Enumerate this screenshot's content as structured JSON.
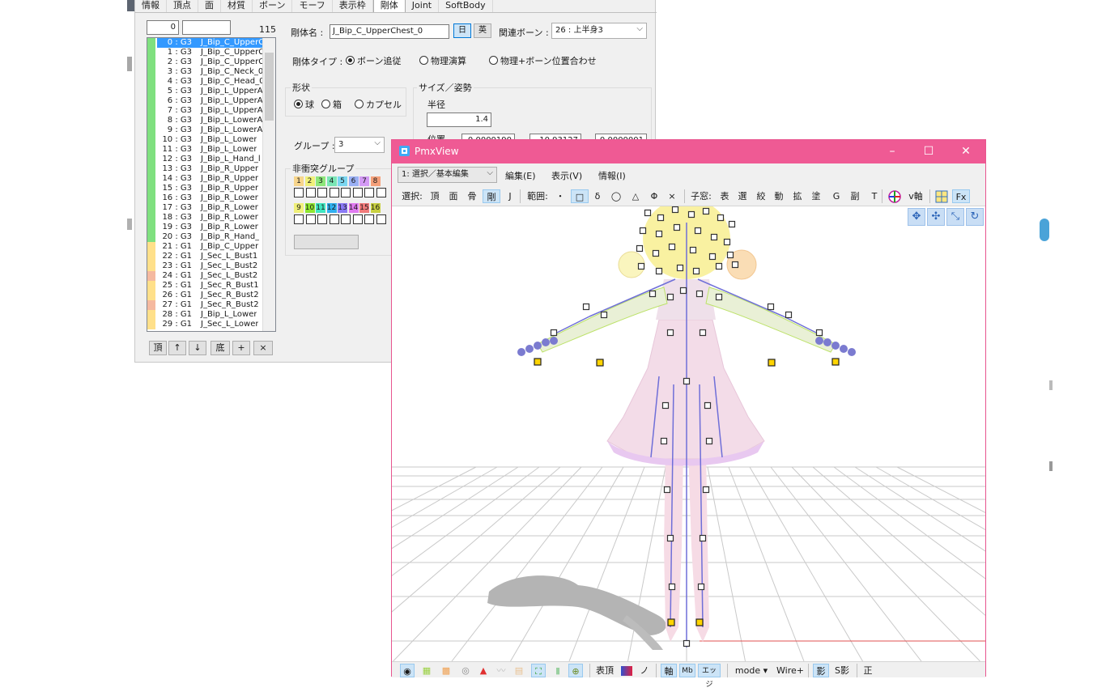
{
  "editor": {
    "tabs": [
      "情報",
      "頂点",
      "面",
      "材質",
      "ボーン",
      "モーフ",
      "表示枠",
      "剛体",
      "Joint",
      "SoftBody"
    ],
    "active_tab": "剛体",
    "index_value": "0",
    "search_value": "",
    "total_count": "115",
    "list_items": [
      {
        "id": "0 : G3",
        "name": "J_Bip_C_UpperC",
        "color": "#7fe07f"
      },
      {
        "id": "1 : G3",
        "name": "J_Bip_C_UpperC",
        "color": "#7fe07f"
      },
      {
        "id": "2 : G3",
        "name": "J_Bip_C_UpperC",
        "color": "#7fe07f"
      },
      {
        "id": "3 : G3",
        "name": "J_Bip_C_Neck_0",
        "color": "#7fe07f"
      },
      {
        "id": "4 : G3",
        "name": "J_Bip_C_Head_0",
        "color": "#7fe07f"
      },
      {
        "id": "5 : G3",
        "name": "J_Bip_L_UpperA",
        "color": "#7fe07f"
      },
      {
        "id": "6 : G3",
        "name": "J_Bip_L_UpperA",
        "color": "#7fe07f"
      },
      {
        "id": "7 : G3",
        "name": "J_Bip_L_UpperA",
        "color": "#7fe07f"
      },
      {
        "id": "8 : G3",
        "name": "J_Bip_L_LowerA",
        "color": "#7fe07f"
      },
      {
        "id": "9 : G3",
        "name": "J_Bip_L_LowerA",
        "color": "#7fe07f"
      },
      {
        "id": "10 : G3",
        "name": "J_Bip_L_Lower",
        "color": "#7fe07f"
      },
      {
        "id": "11 : G3",
        "name": "J_Bip_L_Lower",
        "color": "#7fe07f"
      },
      {
        "id": "12 : G3",
        "name": "J_Bip_L_Hand_l",
        "color": "#7fe07f"
      },
      {
        "id": "13 : G3",
        "name": "J_Bip_R_Upper",
        "color": "#7fe07f"
      },
      {
        "id": "14 : G3",
        "name": "J_Bip_R_Upper",
        "color": "#7fe07f"
      },
      {
        "id": "15 : G3",
        "name": "J_Bip_R_Upper",
        "color": "#7fe07f"
      },
      {
        "id": "16 : G3",
        "name": "J_Bip_R_Lower",
        "color": "#7fe07f"
      },
      {
        "id": "17 : G3",
        "name": "J_Bip_R_Lower",
        "color": "#7fe07f"
      },
      {
        "id": "18 : G3",
        "name": "J_Bip_R_Lower",
        "color": "#7fe07f"
      },
      {
        "id": "19 : G3",
        "name": "J_Bip_R_Lower",
        "color": "#7fe07f"
      },
      {
        "id": "20 : G3",
        "name": "J_Bip_R_Hand_",
        "color": "#7fe07f"
      },
      {
        "id": "21 : G1",
        "name": "J_Bip_C_Upper",
        "color": "#ffe08a"
      },
      {
        "id": "22 : G1",
        "name": "J_Sec_L_Bust1",
        "color": "#ffe08a"
      },
      {
        "id": "23 : G1",
        "name": "J_Sec_L_Bust2",
        "color": "#ffe08a"
      },
      {
        "id": "24 : G1",
        "name": "J_Sec_L_Bust2",
        "color": "#f5b9a0"
      },
      {
        "id": "25 : G1",
        "name": "J_Sec_R_Bust1",
        "color": "#ffe08a"
      },
      {
        "id": "26 : G1",
        "name": "J_Sec_R_Bust2",
        "color": "#ffe08a"
      },
      {
        "id": "27 : G1",
        "name": "J_Sec_R_Bust2",
        "color": "#f5b9a0"
      },
      {
        "id": "28 : G1",
        "name": "J_Bip_L_Lower",
        "color": "#ffe08a"
      },
      {
        "id": "29 : G1",
        "name": "J_Sec_L_Lower",
        "color": "#ffe08a"
      }
    ],
    "list_buttons": [
      "頂",
      "↑",
      "↓",
      "底",
      "+",
      "×"
    ],
    "body_name_label": "剛体名 :",
    "body_name_value": "J_Bip_C_UpperChest_0",
    "lang_jp": "日",
    "lang_en": "英",
    "related_bone_label": "関連ボーン :",
    "related_bone_value": "26 : 上半身3",
    "body_type_label": "剛体タイプ :",
    "body_types": [
      "ボーン追従",
      "物理演算",
      "物理+ボーン位置合わせ"
    ],
    "shape_label": "形状",
    "shapes": [
      "球",
      "箱",
      "カプセル"
    ],
    "size_label": "サイズ／姿勢",
    "radius_label": "半径",
    "radius_value": "1.4",
    "position_label": "位置",
    "position_values": [
      "0.0000190",
      "10.93127",
      "0.0000001"
    ],
    "group_label": "グループ :",
    "group_value": "3",
    "noncollision_label": "非衝突グループ",
    "groups_row1": [
      {
        "n": "1",
        "c": "#f7d58c"
      },
      {
        "n": "2",
        "c": "#f0f07a"
      },
      {
        "n": "3",
        "c": "#8ee67a"
      },
      {
        "n": "4",
        "c": "#7ae6b5"
      },
      {
        "n": "5",
        "c": "#7ad6f0"
      },
      {
        "n": "6",
        "c": "#9ab0f5"
      },
      {
        "n": "7",
        "c": "#d49af5"
      },
      {
        "n": "8",
        "c": "#f5a07a"
      }
    ],
    "groups_row2": [
      {
        "n": "9",
        "c": "#f0f07a"
      },
      {
        "n": "10",
        "c": "#8ee630"
      },
      {
        "n": "11",
        "c": "#40e6c0"
      },
      {
        "n": "12",
        "c": "#30b0f0"
      },
      {
        "n": "13",
        "c": "#8a7af5"
      },
      {
        "n": "14",
        "c": "#e07af0"
      },
      {
        "n": "15",
        "c": "#f07a7a"
      },
      {
        "n": "16",
        "c": "#c8d040"
      }
    ]
  },
  "view": {
    "title": "PmxView",
    "mode_select": "1: 選択／基本編集",
    "menus": [
      "編集(E)",
      "表示(V)",
      "情報(I)"
    ],
    "select_label": "選択:",
    "select_items": [
      "頂",
      "面",
      "骨",
      "剛",
      "J"
    ],
    "range_label": "範囲:",
    "range_items": [
      "・",
      "□",
      "δ",
      "◯",
      "△",
      "Φ",
      "×"
    ],
    "child_label": "子窓:",
    "child_items": [
      "表",
      "選",
      "絞",
      "動",
      "拡",
      "塗",
      "G",
      "副",
      "T"
    ],
    "axis_label": "v軸",
    "fx_label": "Fx",
    "bottom_items": [
      "表頂",
      "ノ",
      "軸",
      "エッジ",
      "mode ▾",
      "Wire+",
      "影",
      "S影",
      "正"
    ],
    "accent_color": "#ef5a94"
  }
}
